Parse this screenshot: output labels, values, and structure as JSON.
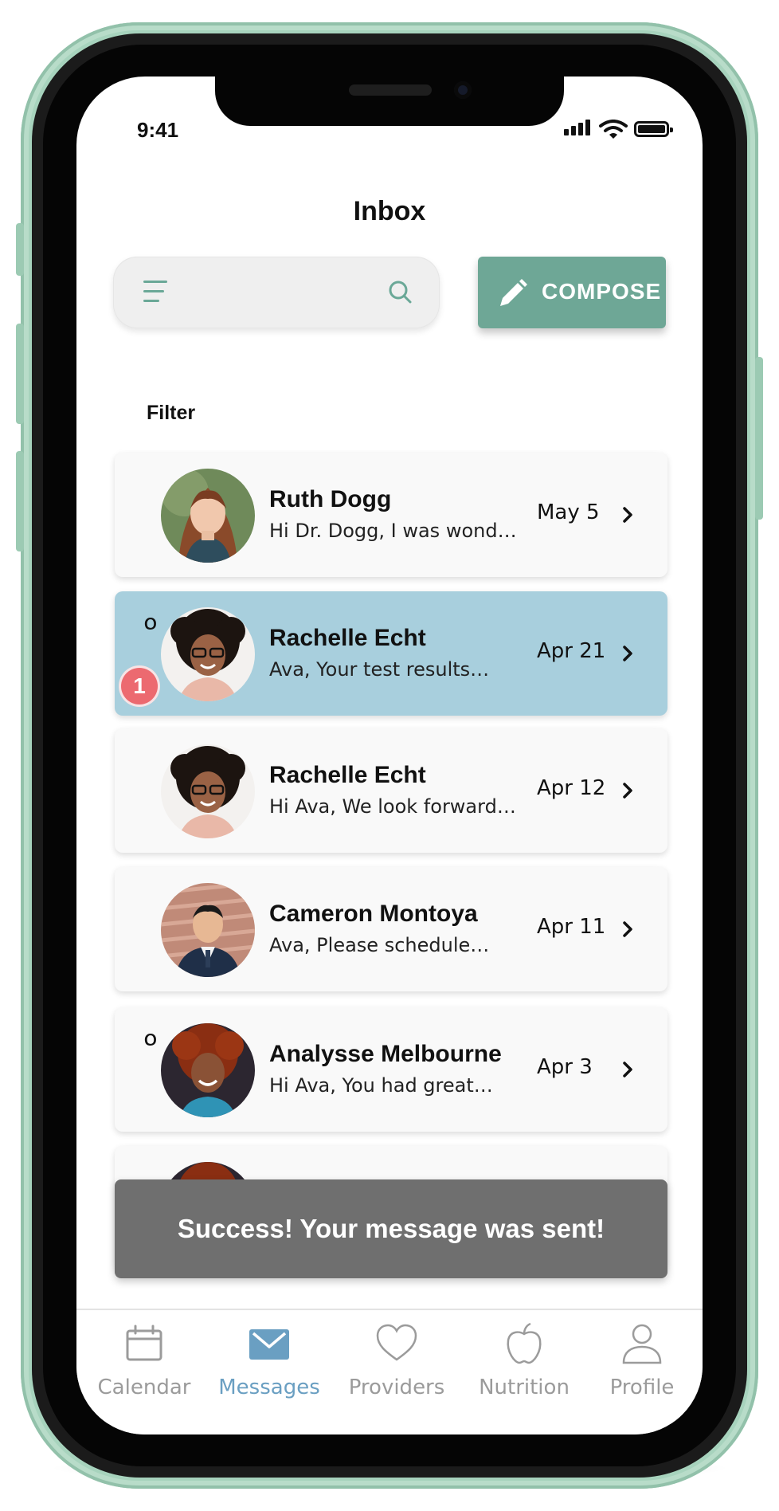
{
  "status_bar": {
    "time": "9:41"
  },
  "header": {
    "title": "Inbox"
  },
  "search": {
    "placeholder": ""
  },
  "compose": {
    "label": "COMPOSE"
  },
  "filter": {
    "label": "Filter"
  },
  "messages": [
    {
      "sender": "Ruth Dogg",
      "preview": "Hi Dr. Dogg, I was wond…",
      "date": "May 5",
      "attachment": false,
      "unread": null,
      "selected": false
    },
    {
      "sender": "Rachelle Echt",
      "preview": "Ava, Your test results…",
      "date": "Apr 21",
      "attachment": true,
      "attachment_symbol": "໐",
      "unread": "1",
      "selected": true
    },
    {
      "sender": "Rachelle Echt",
      "preview": "Hi Ava, We look forward…",
      "date": "Apr 12",
      "attachment": false,
      "unread": null,
      "selected": false
    },
    {
      "sender": "Cameron Montoya",
      "preview": "Ava, Please schedule…",
      "date": "Apr 11",
      "attachment": false,
      "unread": null,
      "selected": false
    },
    {
      "sender": "Analysse Melbourne",
      "preview": "Hi Ava, You had great…",
      "date": "Apr 3",
      "attachment": true,
      "attachment_symbol": "໐",
      "unread": null,
      "selected": false
    }
  ],
  "toast": {
    "text": "Success! Your message was sent!"
  },
  "tabs": [
    {
      "label": "Calendar",
      "icon": "calendar-icon",
      "active": false
    },
    {
      "label": "Messages",
      "icon": "envelope-icon",
      "active": true
    },
    {
      "label": "Providers",
      "icon": "heart-icon",
      "active": false
    },
    {
      "label": "Nutrition",
      "icon": "apple-icon",
      "active": false
    },
    {
      "label": "Profile",
      "icon": "person-icon",
      "active": false
    }
  ],
  "colors": {
    "accent": "#6ea796",
    "selected_row": "#a8cfdd",
    "badge": "#ec6a70",
    "toast": "#6f6f6f",
    "tab_active": "#6a9fc2",
    "tab_inactive": "#9b9b9b",
    "phone_frame": "#a7d3bd"
  }
}
